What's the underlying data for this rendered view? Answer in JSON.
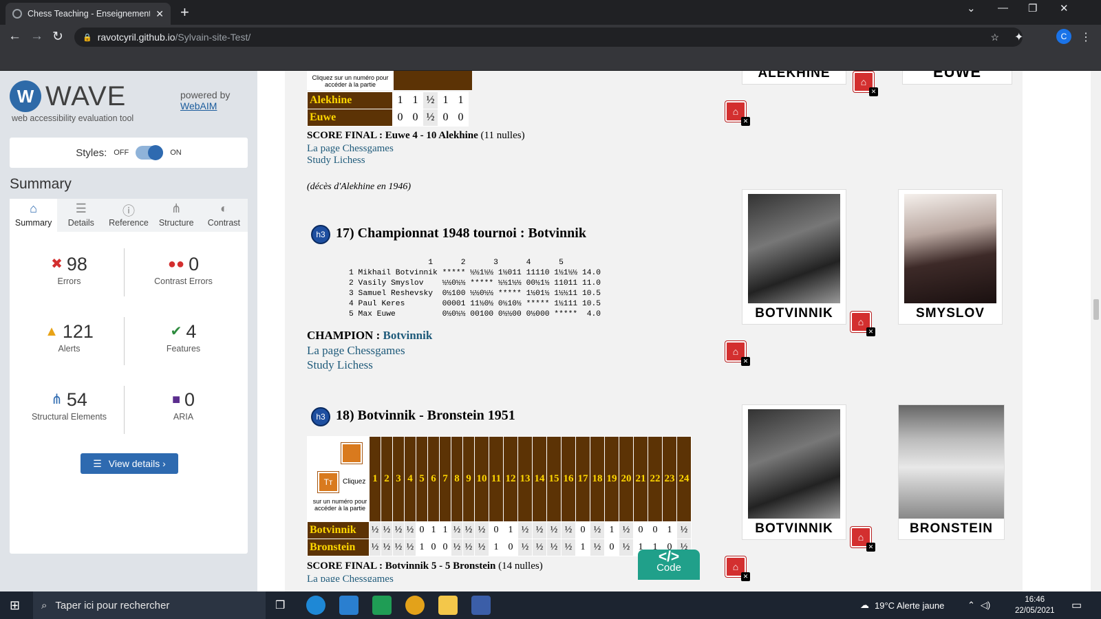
{
  "browser": {
    "tab_title": "Chess Teaching - Enseignement d",
    "url_host": "ravotcyril.github.io",
    "url_path": "/Sylvain-site-Test/",
    "avatar_letter": "C"
  },
  "wave": {
    "logo_text": "WAVE",
    "logo_letter": "W",
    "subtitle": "web accessibility evaluation tool",
    "powered_by": "powered by",
    "webaim": "WebAIM",
    "styles_label": "Styles:",
    "styles_off": "OFF",
    "styles_on": "ON",
    "summary_heading": "Summary",
    "tabs": [
      {
        "label": "Summary",
        "icon": "home-icon"
      },
      {
        "label": "Details",
        "icon": "list-icon"
      },
      {
        "label": "Reference",
        "icon": "info-icon"
      },
      {
        "label": "Structure",
        "icon": "structure-icon"
      },
      {
        "label": "Contrast",
        "icon": "contrast-icon"
      }
    ],
    "stats": {
      "errors": {
        "count": "98",
        "label": "Errors"
      },
      "contrast": {
        "count": "0",
        "label": "Contrast Errors"
      },
      "alerts": {
        "count": "121",
        "label": "Alerts"
      },
      "features": {
        "count": "4",
        "label": "Features"
      },
      "structural": {
        "count": "54",
        "label": "Structural Elements"
      },
      "aria": {
        "count": "0",
        "label": "ARIA"
      }
    },
    "view_details": "View details ›"
  },
  "content": {
    "top_table_note": "Cliquez sur un numéro pour accéder à la partie",
    "alekhine_euwe": {
      "rows": [
        {
          "name": "Alekhine",
          "scores": [
            "1",
            "1",
            "½",
            "1",
            "1"
          ]
        },
        {
          "name": "Euwe",
          "scores": [
            "0",
            "0",
            "½",
            "0",
            "0"
          ]
        }
      ]
    },
    "score1_label": "SCORE FINAL :",
    "score1_value": "Euwe 4 - 10 Alekhine",
    "score1_draws": "(11 nulles)",
    "link_chessgames": "La page Chessgames",
    "link_lichess": "Study Lichess",
    "death_note": "(décès d'Alekhine en 1946)",
    "caption_alekhine": "ALEKHINE",
    "caption_euwe": "EUWE",
    "h3_badge": "h3",
    "section17_title": "17) Championnat 1948 tournoi : Botvinnik",
    "crosstable_header": "                 1      2      3      4      5",
    "crosstable": [
      "1 Mikhail Botvinnik ***** ½½1½½ 1½011 11110 1½1½½ 14.0",
      "2 Vasily Smyslov    ½½0½½ ***** ½½1½½ 00½1½ 11011 11.0",
      "3 Samuel Reshevsky  0½100 ½½0½½ ***** 1½01½ 1½½11 10.5",
      "4 Paul Keres        00001 11½0½ 0½10½ ***** 1½111 10.5",
      "5 Max Euwe          0½0½½ 00100 0½½00 0½000 *****  4.0"
    ],
    "champion_label": "CHAMPION :",
    "champion_name": "Botvinnik",
    "caption_botvinnik": "BOTVINNIK",
    "caption_smyslov": "SMYSLOV",
    "section18_title": "18) Botvinnik - Bronstein 1951",
    "click_word": "Cliquez",
    "click_note": "sur un numéro pour accéder à la partie",
    "tt_icon": "Tт",
    "games_header": [
      "1",
      "2",
      "3",
      "4",
      "5",
      "6",
      "7",
      "8",
      "9",
      "10",
      "11",
      "12",
      "13",
      "14",
      "15",
      "16",
      "17",
      "18",
      "19",
      "20",
      "21",
      "22",
      "23",
      "24"
    ],
    "botvinnik_bronstein": {
      "rows": [
        {
          "name": "Botvinnik",
          "scores": [
            "½",
            "½",
            "½",
            "½",
            "0",
            "1",
            "1",
            "½",
            "½",
            "½",
            "0",
            "1",
            "½",
            "½",
            "½",
            "½",
            "0",
            "½",
            "1",
            "½",
            "0",
            "0",
            "1",
            "½"
          ]
        },
        {
          "name": "Bronstein",
          "scores": [
            "½",
            "½",
            "½",
            "½",
            "1",
            "0",
            "0",
            "½",
            "½",
            "½",
            "1",
            "0",
            "½",
            "½",
            "½",
            "½",
            "1",
            "½",
            "0",
            "½",
            "1",
            "1",
            "0",
            "½"
          ]
        }
      ]
    },
    "score2_label": "SCORE FINAL :",
    "score2_value": "Botvinnik 5 - 5 Bronstein",
    "score2_draws": "(14 nulles)",
    "caption_bronstein": "BRONSTEIN",
    "code_symbol": "</>",
    "code_label": "Code"
  },
  "taskbar": {
    "search_placeholder": "Taper ici pour rechercher",
    "weather": "19°C  Alerte jaune",
    "time": "16:46",
    "date": "22/05/2021"
  }
}
